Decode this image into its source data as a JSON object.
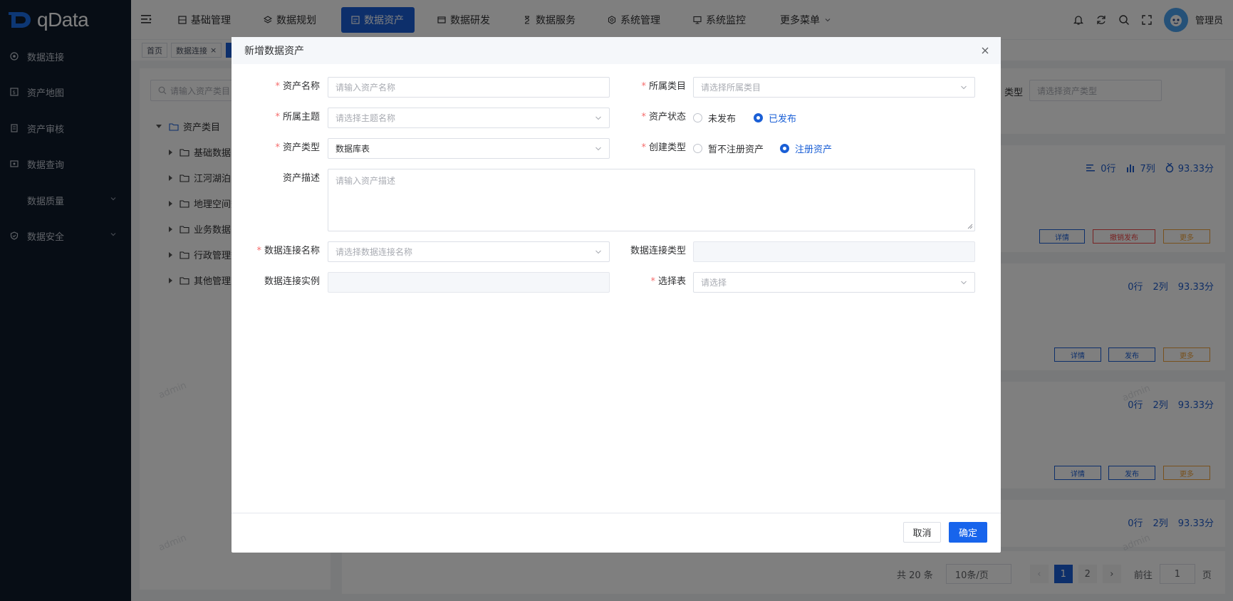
{
  "app": {
    "logo_text": "qData"
  },
  "sidebar": {
    "items": [
      {
        "label": "数据连接",
        "icon": "link-icon"
      },
      {
        "label": "资产地图",
        "icon": "map-icon"
      },
      {
        "label": "资产审核",
        "icon": "audit-icon"
      },
      {
        "label": "数据查询",
        "icon": "query-icon"
      },
      {
        "label": "数据质量",
        "icon": "quality-icon"
      },
      {
        "label": "数据安全",
        "icon": "shield-icon"
      }
    ]
  },
  "topnav": {
    "items": [
      {
        "label": "基础管理"
      },
      {
        "label": "数据规划"
      },
      {
        "label": "数据资产"
      },
      {
        "label": "数据研发"
      },
      {
        "label": "数据服务"
      },
      {
        "label": "系统管理"
      },
      {
        "label": "系统监控"
      },
      {
        "label": "更多菜单"
      }
    ],
    "active": "数据资产",
    "user": "管理员"
  },
  "tabs": [
    {
      "label": "首页"
    },
    {
      "label": "数据连接"
    }
  ],
  "background": {
    "search_placeholder": "请输入资产类目",
    "type_label": "类型",
    "type_placeholder": "请选择资产类型",
    "tree": [
      {
        "label": "资产类目"
      },
      {
        "label": "基础数据"
      },
      {
        "label": "江河湖泊"
      },
      {
        "label": "地理空间数"
      },
      {
        "label": "业务数据"
      },
      {
        "label": "行政管理数"
      },
      {
        "label": "其他管理对"
      }
    ],
    "cards": [
      {
        "rows": "0行",
        "cols": "7列",
        "score": "93.33分",
        "actions": [
          "详情",
          "撤销发布",
          "更多"
        ]
      },
      {
        "rows": "0行",
        "cols": "2列",
        "score": "93.33分",
        "actions": [
          "详情",
          "发布",
          "更多"
        ]
      },
      {
        "rows": "0行",
        "cols": "2列",
        "score": "93.33分",
        "actions": [
          "详情",
          "发布",
          "更多"
        ]
      },
      {
        "rows": "0行",
        "cols": "2列",
        "score": "93.33分"
      }
    ],
    "pager": {
      "total": "共 20 条",
      "page_size": "10条/页",
      "pages": [
        "1",
        "2"
      ],
      "goto_label": "前往",
      "goto_value": "1",
      "goto_unit": "页"
    },
    "watermark": "admin"
  },
  "modal": {
    "title": "新增数据资产",
    "fields": {
      "asset_name": {
        "label": "资产名称",
        "placeholder": "请输入资产名称"
      },
      "category": {
        "label": "所属类目",
        "placeholder": "请选择所属类目"
      },
      "theme": {
        "label": "所属主题",
        "placeholder": "请选择主题名称"
      },
      "status": {
        "label": "资产状态",
        "options": [
          "未发布",
          "已发布"
        ],
        "selected": "已发布"
      },
      "asset_type": {
        "label": "资产类型",
        "value": "数据库表"
      },
      "create_type": {
        "label": "创建类型",
        "options": [
          "暂不注册资产",
          "注册资产"
        ],
        "selected": "注册资产"
      },
      "description": {
        "label": "资产描述",
        "placeholder": "请输入资产描述"
      },
      "conn_name": {
        "label": "数据连接名称",
        "placeholder": "请选择数据连接名称"
      },
      "conn_type": {
        "label": "数据连接类型",
        "value": ""
      },
      "conn_instance": {
        "label": "数据连接实例",
        "value": ""
      },
      "table": {
        "label": "选择表",
        "placeholder": "请选择"
      }
    },
    "cancel": "取消",
    "confirm": "确定"
  },
  "colors": {
    "primary": "#1a5fd6",
    "sidebar": "#0e1a2b",
    "required": "#f56c6c"
  }
}
